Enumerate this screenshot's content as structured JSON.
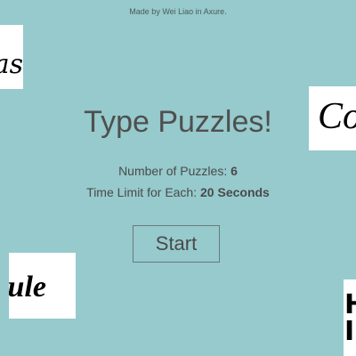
{
  "credit": "Made by Wei Liao in Axure.",
  "title": "Type Puzzles!",
  "info": {
    "puzzles_label": "Number of Puzzles: ",
    "puzzles_value": "6",
    "time_label": "Time Limit for Each: ",
    "time_value": "20 Seconds"
  },
  "start_label": "Start",
  "cards": {
    "card_1": "as",
    "card_2": "Co",
    "card_3": "ule",
    "card_4": "H\nI"
  },
  "colors": {
    "background": "#96cacc",
    "text": "#4a4a4a",
    "card": "#ffffff"
  }
}
